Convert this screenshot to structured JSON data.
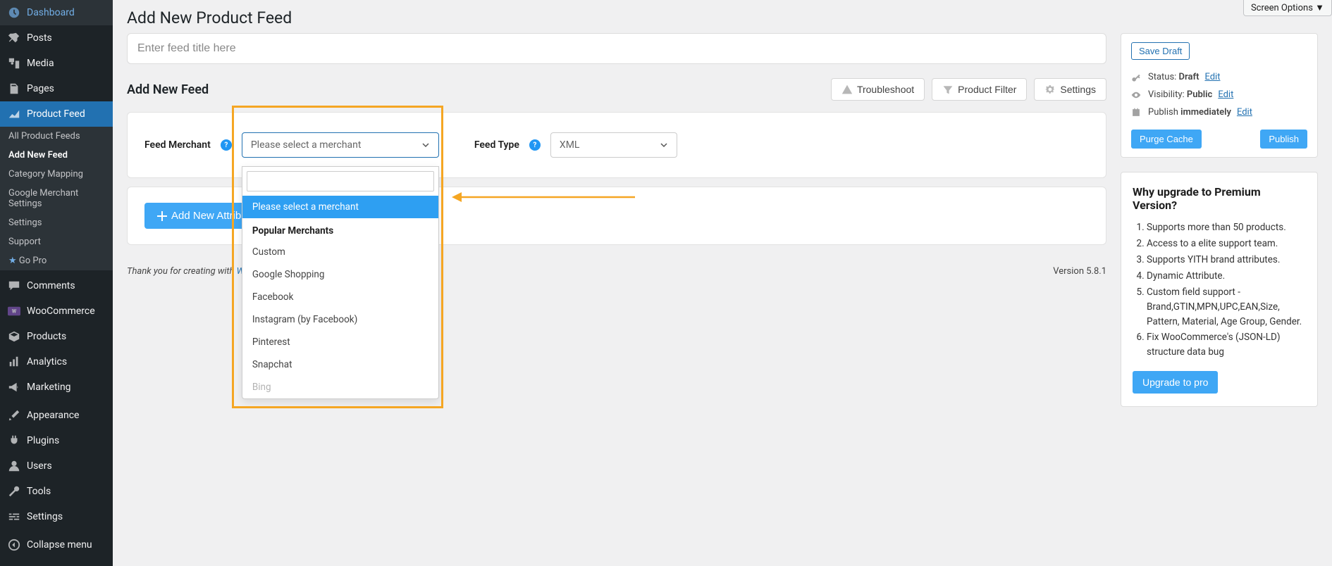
{
  "screen_options": "Screen Options ▼",
  "sidebar": {
    "items": [
      {
        "label": "Dashboard",
        "icon": "dashboard"
      },
      {
        "label": "Posts",
        "icon": "pin"
      },
      {
        "label": "Media",
        "icon": "media"
      },
      {
        "label": "Pages",
        "icon": "pages"
      },
      {
        "label": "Product Feed",
        "icon": "chart",
        "active": true
      },
      {
        "label": "Comments",
        "icon": "comment"
      },
      {
        "label": "WooCommerce",
        "icon": "woo"
      },
      {
        "label": "Products",
        "icon": "box"
      },
      {
        "label": "Analytics",
        "icon": "bars"
      },
      {
        "label": "Marketing",
        "icon": "megaphone"
      },
      {
        "label": "Appearance",
        "icon": "brush"
      },
      {
        "label": "Plugins",
        "icon": "plug"
      },
      {
        "label": "Users",
        "icon": "user"
      },
      {
        "label": "Tools",
        "icon": "wrench"
      },
      {
        "label": "Settings",
        "icon": "sliders"
      },
      {
        "label": "Collapse menu",
        "icon": "collapse"
      }
    ],
    "submenu": [
      "All Product Feeds",
      "Add New Feed",
      "Category Mapping",
      "Google Merchant Settings",
      "Settings",
      "Support",
      "Go Pro"
    ],
    "submenu_current": "Add New Feed"
  },
  "page": {
    "title": "Add New Product Feed",
    "title_placeholder": "Enter feed title here"
  },
  "feed_section": {
    "heading": "Add New Feed",
    "actions": {
      "troubleshoot": "Troubleshoot",
      "filter": "Product Filter",
      "settings": "Settings"
    },
    "merchant_label": "Feed Merchant",
    "feed_type_label": "Feed Type",
    "feed_type_value": "XML",
    "merchant_placeholder": "Please select a merchant",
    "dropdown": {
      "selected": "Please select a merchant",
      "group_header": "Popular Merchants",
      "options": [
        "Custom",
        "Google Shopping",
        "Facebook",
        "Instagram (by Facebook)",
        "Pinterest",
        "Snapchat",
        "Bing"
      ]
    },
    "add_attribute": "Add New Attribute"
  },
  "publish": {
    "save_draft": "Save Draft",
    "status_prefix": "Status: ",
    "status_value": "Draft",
    "status_edit": "Edit",
    "visibility_prefix": "Visibility: ",
    "visibility_value": "Public",
    "visibility_edit": "Edit",
    "publish_prefix": "Publish ",
    "publish_value": "immediately",
    "publish_edit": "Edit",
    "purge": "Purge Cache",
    "publish_btn": "Publish"
  },
  "upgrade": {
    "heading": "Why upgrade to Premium Version?",
    "items": [
      "Supports more than 50 products.",
      "Access to a elite support team.",
      "Supports YITH brand attributes.",
      "Dynamic Attribute.",
      "Custom field support - Brand,GTIN,MPN,UPC,EAN,Size, Pattern, Material, Age Group, Gender.",
      "Fix WooCommerce's (JSON-LD) structure data bug"
    ],
    "button": "Upgrade to pro"
  },
  "footer": {
    "thanks_prefix": "Thank you for creating with ",
    "wp": "WordPress",
    "version": "Version 5.8.1"
  }
}
